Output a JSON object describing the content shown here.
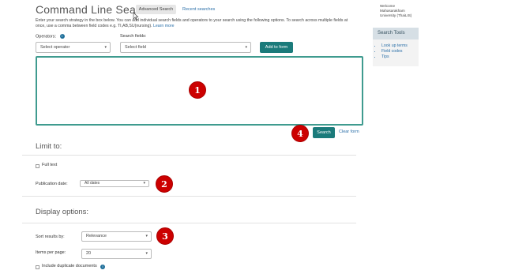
{
  "header": {
    "title": "Command Line Search",
    "tab_advanced": "Advanced Search",
    "tab_recent": "Recent searches"
  },
  "intro": {
    "text": "Enter your search strategy in the box below. You can add individual search fields and operators to your search using the following options. To search across multiple fields at once, use a comma between field codes e.g. TI,AB,SU(nursing).",
    "learn_more": "Learn more"
  },
  "builder": {
    "operators_label": "Operators:",
    "operators_info": "i",
    "operators_value": "Select operator",
    "fields_label": "Search fields:",
    "fields_value": "Select field",
    "add_button": "Add to form",
    "query_value": ""
  },
  "actions": {
    "search_button": "Search",
    "clear_link": "Clear form"
  },
  "limit": {
    "heading": "Limit to:",
    "full_text_label": "Full text",
    "pub_date_label": "Publication date:",
    "pub_date_value": "All dates"
  },
  "display": {
    "heading": "Display options:",
    "sort_label": "Sort results by:",
    "sort_value": "Relevance",
    "items_label": "Items per page:",
    "items_value": "20",
    "duplicates_label": "Include duplicate documents",
    "duplicates_info": "i"
  },
  "sidebar": {
    "welcome": "Welcome Mahasarakham University (ThaiLIS)",
    "tools_heading": "Search Tools",
    "tools": [
      "Look up terms",
      "Field codes",
      "Tips"
    ]
  },
  "annotations": {
    "one": "1",
    "two": "2",
    "three": "3",
    "four": "4"
  },
  "icons": {
    "caret": "▾"
  },
  "colors": {
    "primary_button": "#1b7b7b",
    "textbox_border": "#3f9b8f",
    "link": "#2a6fa8",
    "annotation": "#cc0000"
  }
}
